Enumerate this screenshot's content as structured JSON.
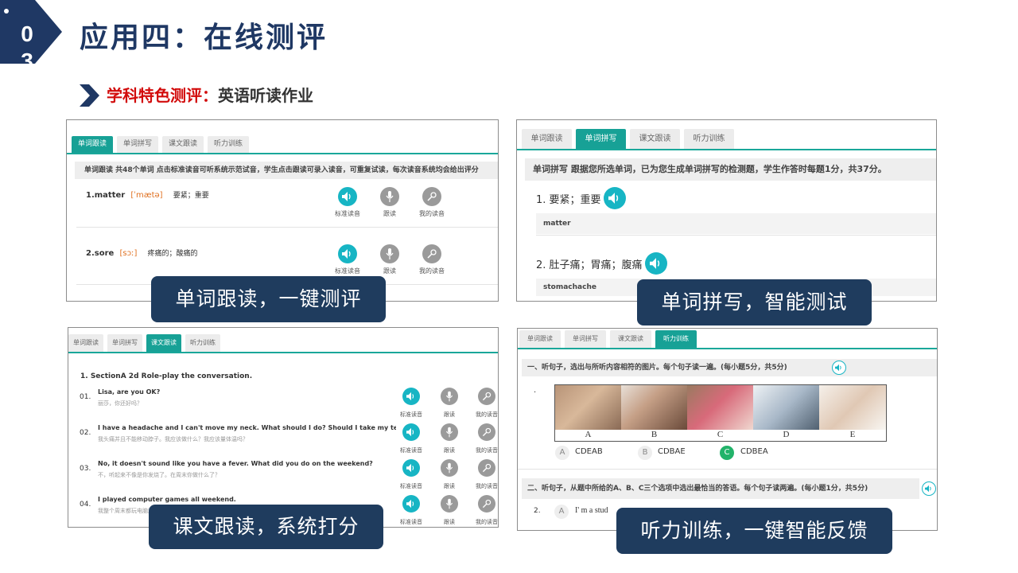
{
  "header": {
    "badge_number": "0",
    "badge_number_2": "3",
    "title": "应用四：在线测评",
    "subtitle_red": "学科特色测评：",
    "subtitle_dark": "英语听读作业"
  },
  "colors": {
    "title": "#1f3864",
    "accent_red": "#d20b0b",
    "teal": "#17a196",
    "caption_bg": "#1f3c5e"
  },
  "panel1": {
    "tabs": [
      "单词跟读",
      "单词拼写",
      "课文跟读",
      "听力训练"
    ],
    "active_tab": 0,
    "info": "单词跟读 共48个单词 点击标准读音可听系统示范试音，学生点击跟读可录入读音，可重复试读，每次读音系统均会给出评分",
    "words": [
      {
        "word": "1.matter",
        "phonetic": "[ˈmætə]",
        "meaning": "要紧；重要"
      },
      {
        "word": "2.sore",
        "phonetic": "[sɔː]",
        "meaning": "疼痛的；酸痛的"
      }
    ],
    "buttons": [
      "标准读音",
      "跟读",
      "我的读音"
    ],
    "caption": "单词跟读，一键测评"
  },
  "panel2": {
    "tabs": [
      "单词跟读",
      "单词拼写",
      "课文跟读",
      "听力训练"
    ],
    "active_tab": 1,
    "info": "单词拼写 跟据您所选单词，已为您生成单词拼写的检测题，学生作答时每题1分，共37分。",
    "items": [
      {
        "prompt": "1. 要紧；重要",
        "answer": "matter"
      },
      {
        "prompt": "2. 肚子痛；胃痛；腹痛",
        "answer": "stomachache"
      }
    ],
    "caption": "单词拼写，智能测试"
  },
  "panel3": {
    "tabs": [
      "单词跟读",
      "单词拼写",
      "课文跟读",
      "听力训练"
    ],
    "active_tab": 2,
    "heading": "1. SectionA 2d Role-play the conversation.",
    "lines": [
      {
        "num": "01.",
        "en": "Lisa, are you OK?",
        "zh": "丽莎，你还好吗？"
      },
      {
        "num": "02.",
        "en": "I have a headache and I can't move my neck. What should I do? Should I take my temperature?",
        "zh": "我头痛并且不能移动脖子。我应该做什么？我应该量体温吗？"
      },
      {
        "num": "03.",
        "en": "No, it doesn't sound like you have a fever. What did you do on the weekend?",
        "zh": "不，听起来不像是你发烧了。在周末你做什么了？"
      },
      {
        "num": "04.",
        "en": "I played computer games all weekend.",
        "zh": "我整个周末都玩电脑游戏。"
      }
    ],
    "buttons": [
      "标准读音",
      "跟读",
      "我的读音"
    ],
    "caption": "课文跟读，系统打分"
  },
  "panel4": {
    "tabs": [
      "单词跟读",
      "单词拼写",
      "课文跟读",
      "听力训练"
    ],
    "active_tab": 3,
    "section1": "一、听句子，选出与所听内容相符的图片。每个句子读一遍。(每小题5分，共5分)",
    "dot": ".",
    "pic_labels": [
      "A",
      "B",
      "C",
      "D",
      "E"
    ],
    "options": [
      {
        "letter": "A",
        "text": "CDEAB"
      },
      {
        "letter": "B",
        "text": "CDBAE"
      },
      {
        "letter": "C",
        "text": "CDBEA"
      }
    ],
    "section2": "二、听句子，从题中所给的A、B、C三个选项中选出最恰当的答语。每个句子读两遍。(每小题1分，共5分)",
    "q2_num": "2.",
    "q2_letter": "A",
    "q2_text": "I' m a stud",
    "caption": "听力训练，一键智能反馈"
  }
}
